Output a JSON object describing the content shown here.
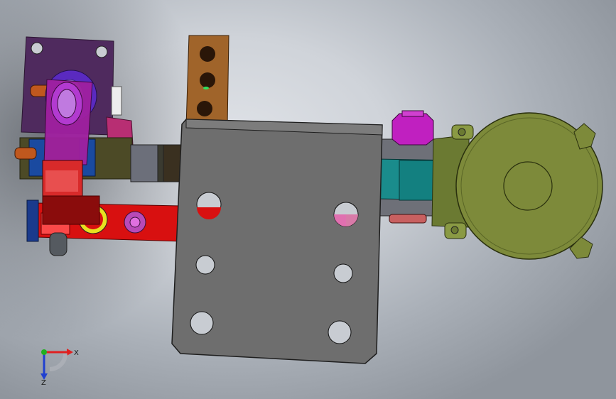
{
  "viewport": {
    "background_center": "#dfe2e7",
    "background_edge": "#8f959d"
  },
  "triad": {
    "x_label": "X",
    "z_label": "Z",
    "x_color": "#e02020",
    "y_color": "#20b020",
    "z_color": "#2040d0"
  },
  "parts": [
    {
      "name": "main-plate",
      "color": "#6e6e6e"
    },
    {
      "name": "bronze-strip",
      "color": "#a0642a"
    },
    {
      "name": "purple-bracket",
      "color": "#5a2a6e"
    },
    {
      "name": "red-bar",
      "color": "#d81010"
    },
    {
      "name": "gear-disc",
      "color": "#7d8a3a"
    },
    {
      "name": "teal-coupler",
      "color": "#1a8c8c"
    },
    {
      "name": "magenta-nut",
      "color": "#c020c0"
    }
  ]
}
